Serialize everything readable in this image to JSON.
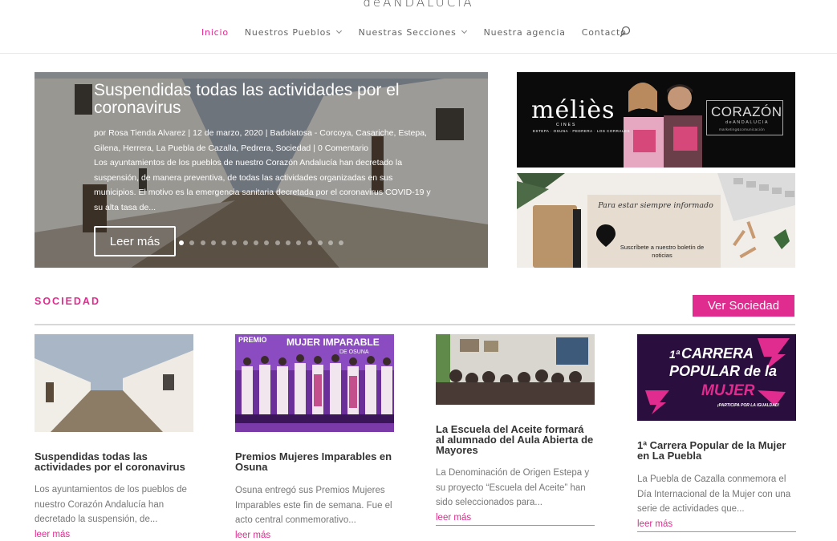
{
  "header": {
    "logo_text": "deANDALUCiA",
    "nav": [
      {
        "label": "Inicio",
        "active": true,
        "dropdown": false
      },
      {
        "label": "Nuestros Pueblos",
        "active": false,
        "dropdown": true
      },
      {
        "label": "Nuestras Secciones",
        "active": false,
        "dropdown": true
      },
      {
        "label": "Nuestra agencia",
        "active": false,
        "dropdown": false
      },
      {
        "label": "Contacto",
        "active": false,
        "dropdown": false
      }
    ],
    "search_icon": "search-icon"
  },
  "hero": {
    "title": "Suspendidas todas las actividades por el coronavirus",
    "meta": {
      "author": "por Rosa Tienda Alvarez",
      "date": "12 de marzo, 2020",
      "categories": "Badolatosa - Corcoya, Casariche, Estepa, Gilena, Herrera, La Puebla de Cazalla, Pedrera, Sociedad",
      "comments": "0 Comentario",
      "separator": "|"
    },
    "excerpt": "Los ayuntamientos de los pueblos de nuestro Corazón Andalucía han decretado la suspensión, de manera preventiva, de todas las actividades organizadas en sus municipios. El motivo es la emergencia sanitaria decretada por el coronavirus COVID-19 y su alta tasa de...",
    "button": "Leer más",
    "slide_count": 16,
    "active_slide": 1
  },
  "banners": {
    "melies": {
      "brand": "méliès",
      "sub": "CINES",
      "towns": "ESTEPA · OSUNA · PEDRERA · LOS CORRALES",
      "partner": "CORAZÓN",
      "partner_sub": "deANDALUCIA",
      "partner_sub2": "marketing&comunicación"
    },
    "newsletter": {
      "script": "Para estar siempre informado",
      "text": "Suscríbete a nuestro boletín de noticias"
    }
  },
  "section": {
    "title": "SOCIEDAD",
    "button": "Ver Sociedad",
    "cards": [
      {
        "title": "Suspendidas todas las actividades por el coronavirus",
        "excerpt": "Los ayuntamientos de los pueblos de nuestro Corazón Andalucía han decretado la suspensión, de...",
        "more": "leer más"
      },
      {
        "title": "Premios Mujeres Imparables en Osuna",
        "excerpt": "Osuna entregó sus Premios Mujeres Imparables este fin de semana. Fue el acto central conmemorativo...",
        "more": "leer más",
        "img_text": {
          "premio": "PREMIO",
          "headline": "MUJER IMPARABLE",
          "place": "DE OSUNA"
        }
      },
      {
        "title": "La Escuela del Aceite formará al alumnado del Aula Abierta de Mayores",
        "excerpt": "La Denominación de Origen Estepa y su proyecto “Escuela del Aceite” han sido seleccionados para...",
        "more": "leer más"
      },
      {
        "title": "1ª Carrera Popular de la Mujer en La Puebla",
        "excerpt": "La Puebla de Cazalla conmemora el Día Internacional de la Mujer con una serie de actividades que...",
        "more": "leer más",
        "img_text": {
          "line1": "1ª",
          "line2": "CARRERA",
          "line3": "POPULAR de la",
          "line4": "MUJER",
          "tag": "¡PARTICIPA POR LA IGUALDAD!"
        }
      }
    ]
  },
  "colors": {
    "accent": "#e02b8f",
    "text": "#555555",
    "title": "#333333"
  }
}
